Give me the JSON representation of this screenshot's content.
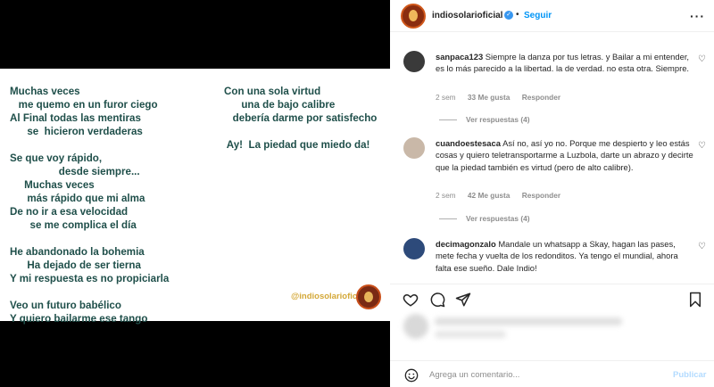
{
  "post": {
    "poem_left": "Muchas veces\n   me quemo en un furor ciego\nAl Final todas las mentiras\n      se  hicieron verdaderas\n\nSe que voy rápido,\n                 desde siempre...\n     Muchas veces\n      más rápido que mi alma\nDe no ir a esa velocidad\n       se me complica el día\n\nHe abandonado la bohemia\n      Ha dejado de ser tierna\nY mi respuesta es no propiciarla\n\nVeo un futuro babélico\nY quiero bailarme ese tango",
    "poem_right": "Con una sola virtud\n      una de bajo calibre\n   debería darme por satisfecho\n\n Ay!  La piedad que miedo da!",
    "watermark": "@indiosolarioficial"
  },
  "header": {
    "username": "indiosolarioficial",
    "separator": "•",
    "follow_label": "Seguir",
    "more_label": "···"
  },
  "comments": [
    {
      "username": "sanpaca123",
      "text": "Siempre la danza por tus letras. y Bailar a mi entender, es lo más parecido a la libertad. la de verdad. no esta otra. Siempre.",
      "time": "2 sem",
      "likes": "33 Me gusta",
      "reply": "Responder",
      "view_replies": "Ver respuestas (4)",
      "avatar_color": "#3a3a3a"
    },
    {
      "username": "cuandoestesaca",
      "text": "Así no, así yo no. Porque me despierto y leo estás cosas y quiero teletransportarme a Luzbola, darte un abrazo y decirte que la piedad también es virtud (pero de alto calibre).",
      "time": "2 sem",
      "likes": "42 Me gusta",
      "reply": "Responder",
      "view_replies": "Ver respuestas (4)",
      "avatar_color": "#c9b8a8"
    },
    {
      "username": "decimagonzalo",
      "text": "Mandale un whatsapp a Skay, hagan las pases, mete fecha y vuelta de los redonditos. Ya tengo el mundial, ahora falta ese sueño. Dale Indio!",
      "avatar_color": "#2d4a7a"
    }
  ],
  "add_comment": {
    "placeholder": "Agrega un comentario...",
    "publish_label": "Publicar"
  },
  "colors": {
    "accent": "#0095f6",
    "poem_text": "#1f4f4a",
    "watermark": "#d4a838"
  },
  "icons": [
    "verified-icon",
    "more-icon",
    "heart-icon",
    "comment-icon",
    "share-icon",
    "bookmark-icon",
    "emoji-icon"
  ]
}
